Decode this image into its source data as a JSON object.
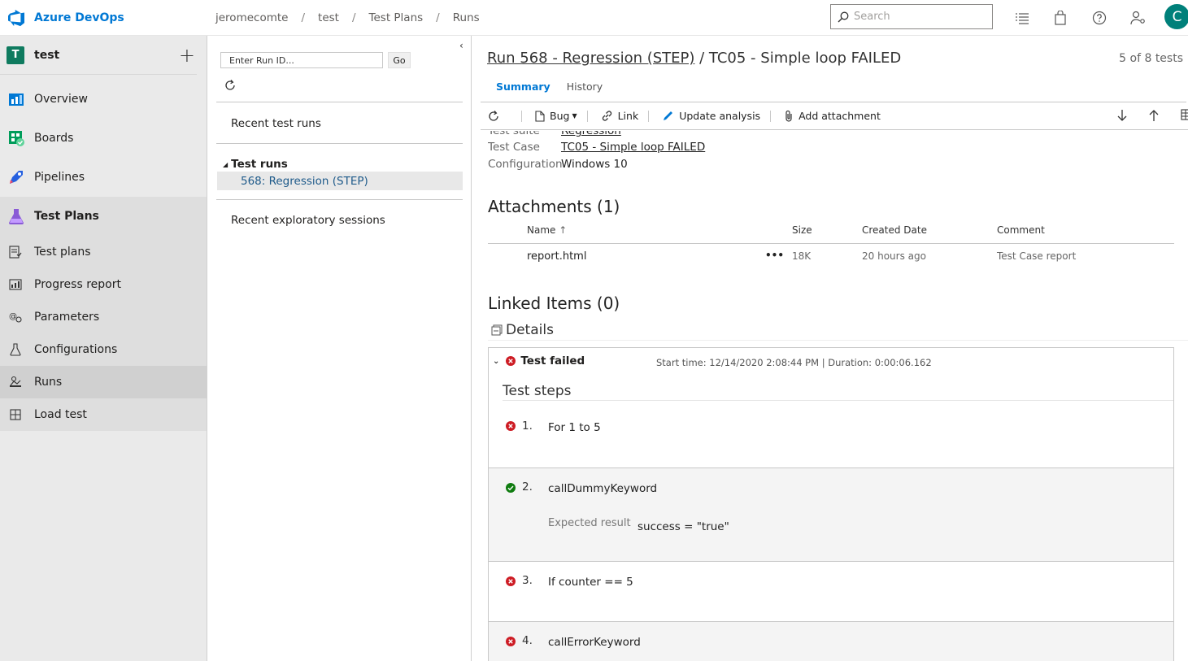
{
  "app": {
    "name": "Azure DevOps"
  },
  "breadcrumbs": [
    "jeromecomte",
    "test",
    "Test Plans",
    "Runs"
  ],
  "search": {
    "placeholder": "Search"
  },
  "user": {
    "initial": "C"
  },
  "project": {
    "initial": "T",
    "name": "test"
  },
  "nav": {
    "overview": "Overview",
    "boards": "Boards",
    "pipelines": "Pipelines",
    "test_plans": "Test Plans",
    "sub": {
      "test_plans": "Test plans",
      "progress_report": "Progress report",
      "parameters": "Parameters",
      "configurations": "Configurations",
      "runs": "Runs",
      "load_test": "Load test"
    }
  },
  "runs_panel": {
    "run_id_placeholder": "Enter Run ID...",
    "go_label": "Go",
    "recent_test_runs": "Recent test runs",
    "test_runs_header": "Test runs",
    "selected_run": "568: Regression (STEP)",
    "recent_exploratory": "Recent exploratory sessions"
  },
  "main": {
    "title_link": "Run 568 - Regression (STEP)",
    "title_rest": " / TC05 - Simple loop FAILED",
    "count": "5 of 8 tests",
    "tabs": [
      "Summary",
      "History"
    ],
    "toolbar": {
      "bug": "Bug",
      "link": "Link",
      "update_analysis": "Update analysis",
      "add_attachment": "Add attachment"
    },
    "props": {
      "suite_label": "Test suite",
      "suite_val": "Regression",
      "case_label": "Test Case",
      "case_val": "TC05 - Simple loop FAILED",
      "config_label": "Configuration",
      "config_val": "Windows 10"
    },
    "attachments": {
      "title": "Attachments (1)",
      "columns": [
        "Name",
        "Size",
        "Created Date",
        "Comment"
      ],
      "rows": [
        {
          "name": "report.html",
          "more": "•••",
          "size": "18K",
          "created": "20 hours ago",
          "comment": "Test Case report"
        }
      ]
    },
    "linked_items": "Linked Items (0)",
    "details": "Details",
    "result": {
      "status": "Test failed",
      "meta": "Start time: 12/14/2020 2:08:44 PM | Duration: 0:00:06.162",
      "steps_title": "Test steps",
      "steps": [
        {
          "num": "1.",
          "text": "For 1 to 5",
          "status": "failed"
        },
        {
          "num": "2.",
          "text": "callDummyKeyword",
          "status": "passed",
          "expected_label": "Expected result",
          "expected": "success = \"true\""
        },
        {
          "num": "3.",
          "text": "If counter == 5",
          "status": "failed"
        },
        {
          "num": "4.",
          "text": "callErrorKeyword",
          "status": "failed"
        }
      ]
    }
  },
  "colors": {
    "accent": "#0078d4",
    "fail": "#cd1c24",
    "pass": "#107c10",
    "avatar": "#00807a"
  }
}
